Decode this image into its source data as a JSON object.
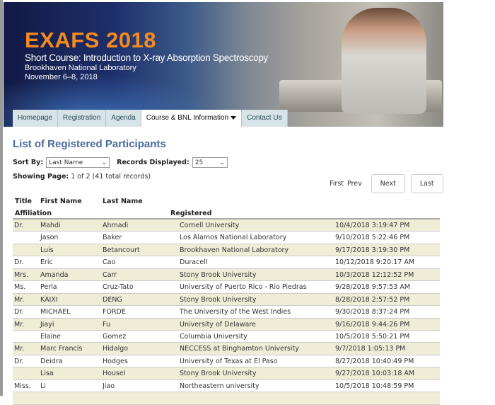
{
  "banner": {
    "title": "EXAFS 2018",
    "subtitle": "Short Course: Introduction to X-ray Absorption Spectroscopy",
    "org": "Brookhaven National Laboratory",
    "dates": "November 6–8, 2018"
  },
  "tabs": [
    {
      "label": "Homepage"
    },
    {
      "label": "Registration"
    },
    {
      "label": "Agenda"
    },
    {
      "label": "Course & BNL Information"
    },
    {
      "label": "Contact Us"
    }
  ],
  "page_title": "List of Registered Participants",
  "sort": {
    "label": "Sort By:",
    "value": "Last Name"
  },
  "records": {
    "label": "Records Displayed:",
    "value": "25"
  },
  "showing": {
    "label": "Showing Page:",
    "value": "1 of 2 (41 total records)"
  },
  "pager": {
    "first": "First",
    "prev": "Prev",
    "next": "Next",
    "last": "Last"
  },
  "columns": {
    "title": "Title",
    "first": "First Name",
    "last": "Last Name",
    "affiliation": "Affiliation",
    "registered": "Registered"
  },
  "rows": [
    [
      "Dr.",
      "Mahdi",
      "Ahmadi",
      "Cornell University",
      "10/4/2018 3:19:47 PM"
    ],
    [
      "",
      "Jason",
      "Baker",
      "Los Alamos National Laboratory",
      "9/10/2018 5:22:46 PM"
    ],
    [
      "",
      "Luis",
      "Betancourt",
      "Brookhaven National Laboratory",
      "9/17/2018 3:19:30 PM"
    ],
    [
      "Dr.",
      "Eric",
      "Cao",
      "Duracell",
      "10/12/2018 9:20:17 AM"
    ],
    [
      "Mrs.",
      "Amanda",
      "Carr",
      "Stony Brook University",
      "10/3/2018 12:12:52 PM"
    ],
    [
      "Ms.",
      "Perla",
      "Cruz-Tato",
      "University of Puerto Rico - Rio Piedras",
      "9/28/2018 9:57:53 AM"
    ],
    [
      "Mr.",
      "KAIXI",
      "DENG",
      "Stony Brook University",
      "8/28/2018 2:57:52 PM"
    ],
    [
      "Dr.",
      "MICHAEL",
      "FORDE",
      "The University of the West Indies",
      "9/30/2018 8:37:24 PM"
    ],
    [
      "Mr.",
      "Jiayi",
      "Fu",
      "University of Delaware",
      "9/16/2018 9:44:26 PM"
    ],
    [
      "",
      "Elaine",
      "Gomez",
      "Columbia University",
      "10/5/2018 5:50:21 PM"
    ],
    [
      "Mr.",
      "Marc Francis",
      "Hidalgo",
      "NECCESS at Binghamton University",
      "9/7/2018 1:05:13 PM"
    ],
    [
      "Dr.",
      "Deidra",
      "Hodges",
      "University of Texas at El Paso",
      "8/27/2018 10:40:49 PM"
    ],
    [
      "",
      "Lisa",
      "Housel",
      "Stony Brook University",
      "9/27/2018 10:03:18 AM"
    ],
    [
      "Miss.",
      "Li",
      "Jiao",
      "Northeastern university",
      "10/5/2018 10:48:59 PM"
    ]
  ]
}
